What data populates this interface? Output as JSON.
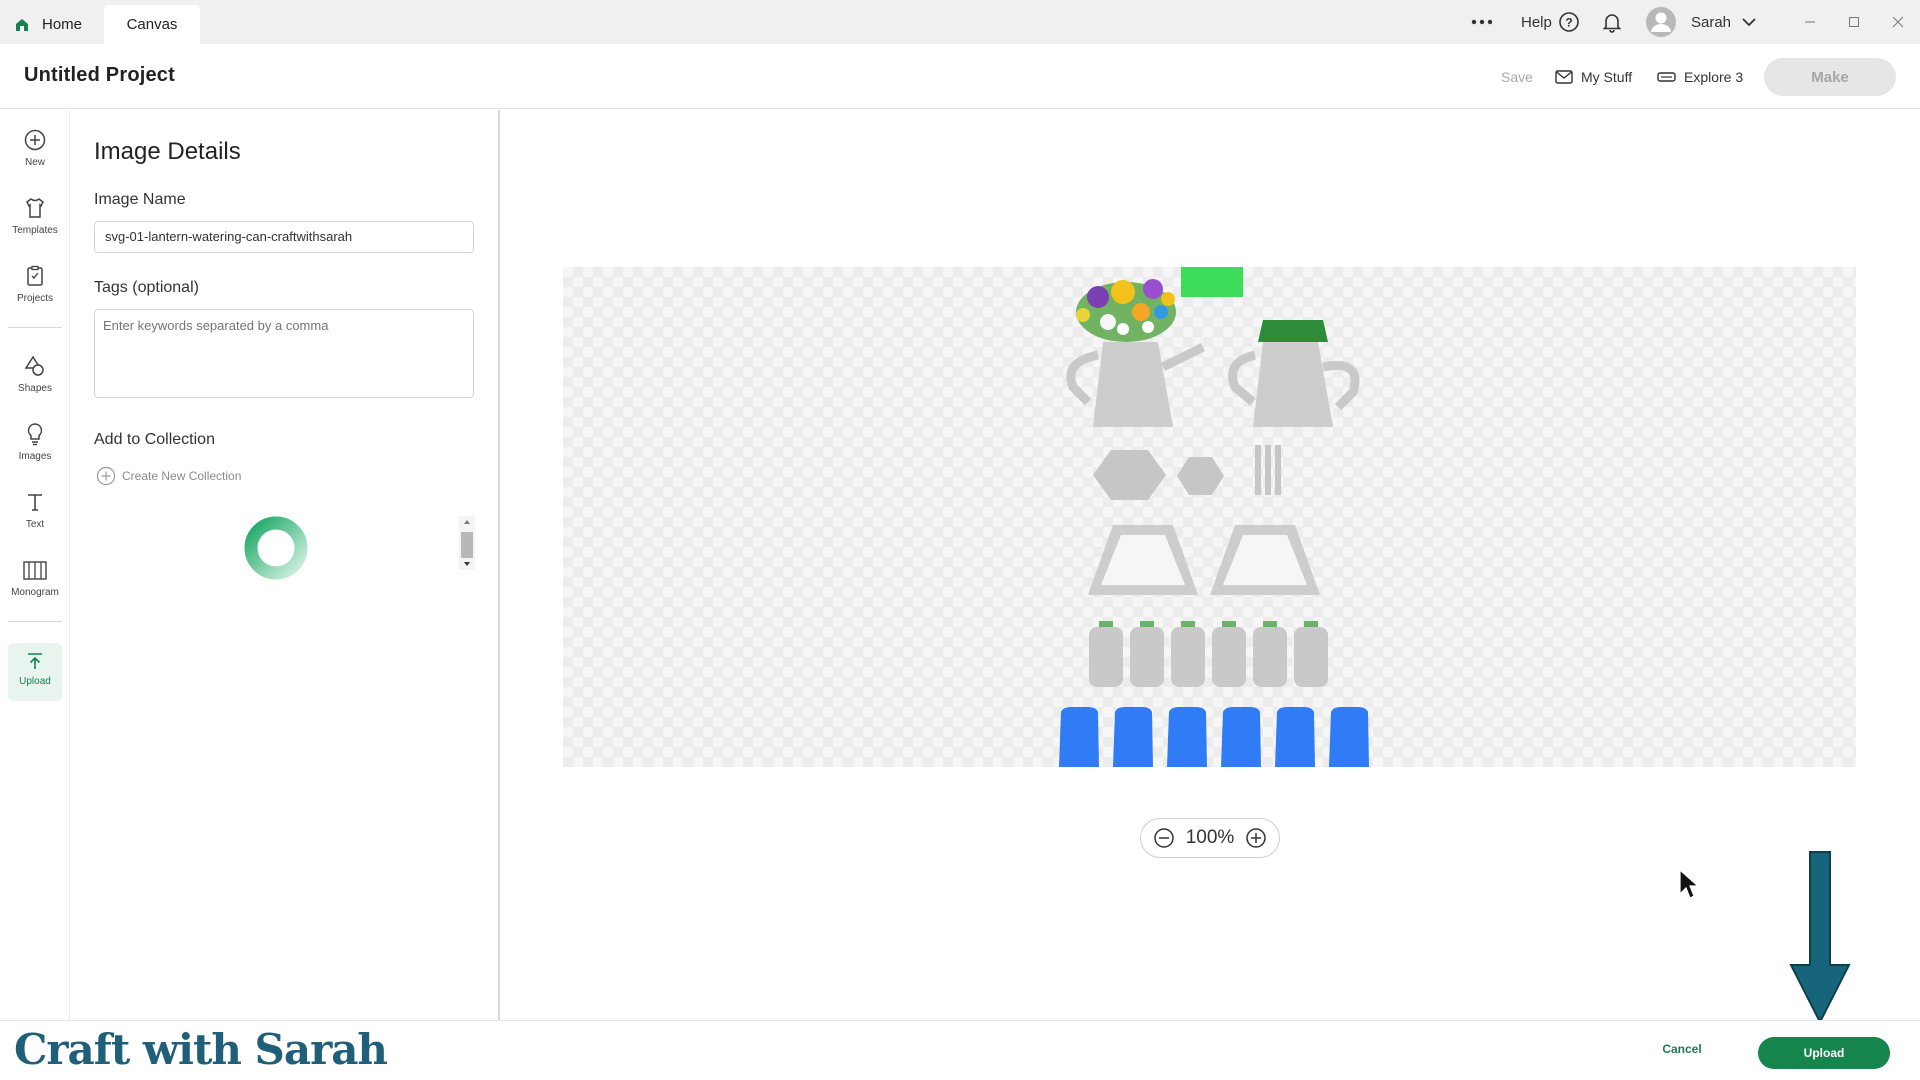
{
  "tabs": {
    "home": "Home",
    "canvas": "Canvas"
  },
  "topbar": {
    "help": "Help",
    "user": "Sarah"
  },
  "header": {
    "project_title": "Untitled Project",
    "save": "Save",
    "my_stuff": "My Stuff",
    "machine": "Explore 3",
    "make": "Make"
  },
  "rail": {
    "items": [
      {
        "label": "New",
        "icon": "plus-circle-icon"
      },
      {
        "label": "Templates",
        "icon": "shirt-icon"
      },
      {
        "label": "Projects",
        "icon": "clipboard-icon"
      },
      {
        "label": "Shapes",
        "icon": "shapes-icon"
      },
      {
        "label": "Images",
        "icon": "lightbulb-icon"
      },
      {
        "label": "Text",
        "icon": "text-icon"
      },
      {
        "label": "Monogram",
        "icon": "monogram-icon"
      },
      {
        "label": "Upload",
        "icon": "upload-icon"
      }
    ]
  },
  "panel": {
    "title": "Image Details",
    "image_name_label": "Image Name",
    "image_name_value": "svg-01-lantern-watering-can-craftwithsarah",
    "tags_label": "Tags (optional)",
    "tags_placeholder": "Enter keywords separated by a comma",
    "collection_label": "Add to Collection",
    "create_collection": "Create New Collection"
  },
  "canvas": {
    "zoom": "100%"
  },
  "footer": {
    "watermark": "Craft with Sarah",
    "cancel": "Cancel",
    "upload": "Upload"
  },
  "colors": {
    "accent": "#15844d",
    "piece_grey": "#c8c8c8",
    "piece_blue": "#2f7cf6",
    "arrow": "#17657a"
  }
}
